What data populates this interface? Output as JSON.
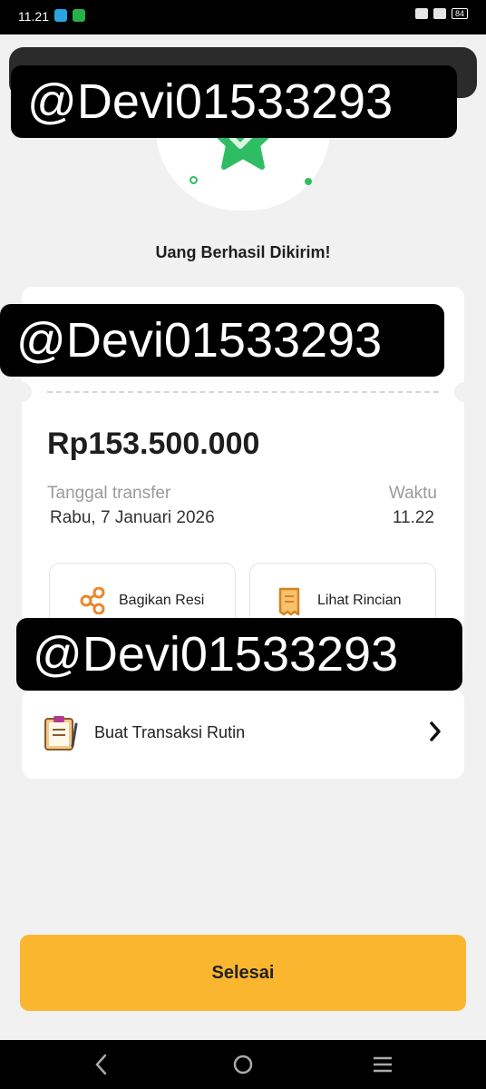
{
  "status_bar": {
    "time": "11.21",
    "battery": "84"
  },
  "success": {
    "title": "Uang Berhasil Dikirim!"
  },
  "receipt": {
    "amount": "Rp153.500.000",
    "date_label": "Tanggal transfer",
    "date_value": "Rabu, 7 Januari 2026",
    "time_label": "Waktu",
    "time_value": "11.22",
    "actions": [
      {
        "label": "Bagikan Resi",
        "icon": "share-icon"
      },
      {
        "label": "Lihat Rincian",
        "icon": "receipt-icon"
      }
    ]
  },
  "routine": {
    "label": "Buat Transaksi Rutin",
    "icon": "clipboard-icon"
  },
  "done_button": {
    "label": "Selesai"
  },
  "watermark": {
    "text": "@Devi01533293"
  },
  "colors": {
    "accent_yellow": "#fbb62f",
    "success_green": "#2fbd64",
    "background": "#f1f1f1"
  }
}
